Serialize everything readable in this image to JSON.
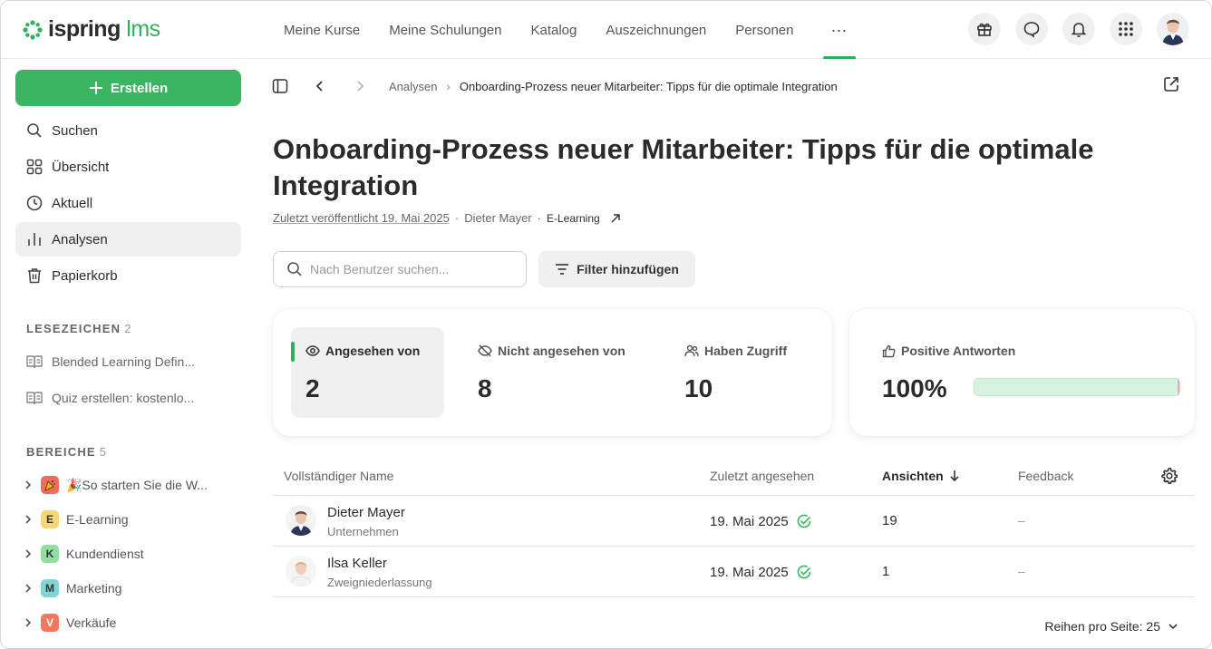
{
  "header": {
    "logo_main": "ispring",
    "logo_accent": "lms",
    "nav": [
      "Meine Kurse",
      "Meine Schulungen",
      "Katalog",
      "Auszeichnungen",
      "Personen"
    ],
    "nav_more": "···"
  },
  "sidebar": {
    "create_label": "Erstellen",
    "items": [
      "Suchen",
      "Übersicht",
      "Aktuell",
      "Analysen",
      "Papierkorb"
    ],
    "bookmarks_title": "LESEZEICHEN",
    "bookmarks_count": "2",
    "bookmarks": [
      "Blended Learning Defin...",
      "Quiz erstellen: kostenlo..."
    ],
    "areas_title": "BEREICHE",
    "areas_count": "5",
    "areas": [
      {
        "letter": "",
        "label": "🎉So starten Sie die W...",
        "color": "#ef6b5b"
      },
      {
        "letter": "E",
        "label": "E-Learning",
        "color": "#f7d774"
      },
      {
        "letter": "K",
        "label": "Kundendienst",
        "color": "#8fe0a0"
      },
      {
        "letter": "M",
        "label": "Marketing",
        "color": "#7fd6d6"
      },
      {
        "letter": "V",
        "label": "Verkäufe",
        "color": "#f2775f"
      }
    ]
  },
  "breadcrumb": {
    "parent": "Analysen",
    "current": "Onboarding-Prozess neuer Mitarbeiter: Tipps für die optimale Integration"
  },
  "page": {
    "title": "Onboarding-Prozess neuer Mitarbeiter: Tipps für die optimale Integration",
    "published": "Zuletzt veröffentlicht 19. Mai 2025",
    "author": "Dieter Mayer",
    "category": "E-Learning"
  },
  "search": {
    "placeholder": "Nach Benutzer suchen..."
  },
  "filter_label": "Filter hinzufügen",
  "stats": [
    {
      "label": "Angesehen von",
      "value": "2"
    },
    {
      "label": "Nicht angesehen von",
      "value": "8"
    },
    {
      "label": "Haben Zugriff",
      "value": "10"
    }
  ],
  "feedback_stat": {
    "label": "Positive Antworten",
    "value": "100%",
    "positive_fraction": 1.0
  },
  "table": {
    "columns": [
      "Vollständiger Name",
      "Zuletzt angesehen",
      "Ansichten",
      "Feedback"
    ],
    "rows": [
      {
        "name": "Dieter Mayer",
        "sub": "Unternehmen",
        "date": "19. Mai 2025",
        "views": "19",
        "feedback": "–"
      },
      {
        "name": "Ilsa Keller",
        "sub": "Zweigniederlassung",
        "date": "19. Mai 2025",
        "views": "1",
        "feedback": "–"
      }
    ]
  },
  "pager": {
    "label": "Reihen pro Seite: 25"
  },
  "colors": {
    "accent": "#3bb561",
    "muted": "#666666"
  }
}
